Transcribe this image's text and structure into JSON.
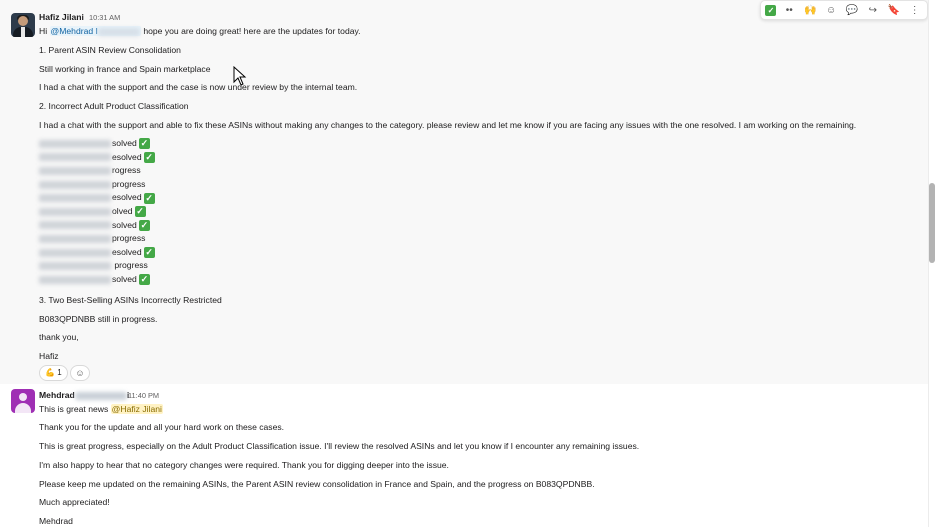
{
  "message1": {
    "author": "Hafiz Jilani",
    "time": "10:31 AM",
    "greeting_pre": "Hi",
    "mention": "@Mehdrad I",
    "greeting_post": "hope you are doing great! here are the updates for today.",
    "heading1": "1. Parent ASIN Review Consolidation",
    "line1": "Still working in france and Spain marketplace",
    "line2": "I had a chat with the support and the case is now under review by the internal team.",
    "heading2": "2. Incorrect Adult Product Classification",
    "line3": "I had a chat with the support and able to fix these ASINs without making any changes to the category. please review and let me know if you are facing any issues with the one resolved. I am working on the remaining.",
    "asin_statuses": [
      {
        "suffix": "solved",
        "check": true
      },
      {
        "suffix": "esolved",
        "check": true
      },
      {
        "suffix": "rogress",
        "check": false
      },
      {
        "suffix": "progress",
        "check": false
      },
      {
        "suffix": "esolved",
        "check": true
      },
      {
        "suffix": "olved",
        "check": true
      },
      {
        "suffix": "solved",
        "check": true
      },
      {
        "suffix": "progress",
        "check": false
      },
      {
        "suffix": "esolved",
        "check": true
      },
      {
        "suffix": " progress",
        "check": false
      },
      {
        "suffix": "solved",
        "check": true
      }
    ],
    "heading3": "3. Two Best-Selling ASINs Incorrectly Restricted",
    "line4": "B083QPDNBB still in progress.",
    "line5": "thank you,",
    "signature": "Hafiz",
    "reaction_emoji": "💪",
    "reaction_count": "1",
    "add_reaction_icon": "☺"
  },
  "message2": {
    "author_first": "Mehdrad",
    "author_last_visible": "i",
    "time": "11:40 PM",
    "line1_pre": "This is great news",
    "mention": "@Hafiz Jilani",
    "line2": "Thank you for the update and all your hard work on these cases.",
    "line3": "This is great progress, especially on the Adult Product Classification issue. I'll review the resolved ASINs and let you know if I encounter any remaining issues.",
    "line4": "I'm also happy to hear that no category changes were required. Thank you for digging deeper into the issue.",
    "line5": "Please keep me updated on the remaining ASINs, the Parent ASIN review consolidation in France and Spain, and the progress on B083QPDNBB.",
    "line6": "Much appreciated!",
    "signature": "Mehdrad"
  },
  "toolbar": {
    "icons": [
      "check-mark-reaction",
      "eyes-reaction",
      "raised-hands-reaction",
      "add-reaction",
      "reply-in-thread",
      "forward",
      "save",
      "more-actions"
    ],
    "glyphs": [
      "✓",
      "••",
      "🙌",
      "☺",
      "💬",
      "↪",
      "🔖",
      "⋮"
    ]
  },
  "colors": {
    "mention_blue": "#1264a3",
    "mention_self": "#fff2c4",
    "check_green": "#44a847",
    "avatar_purple": "#9f2fb4"
  }
}
